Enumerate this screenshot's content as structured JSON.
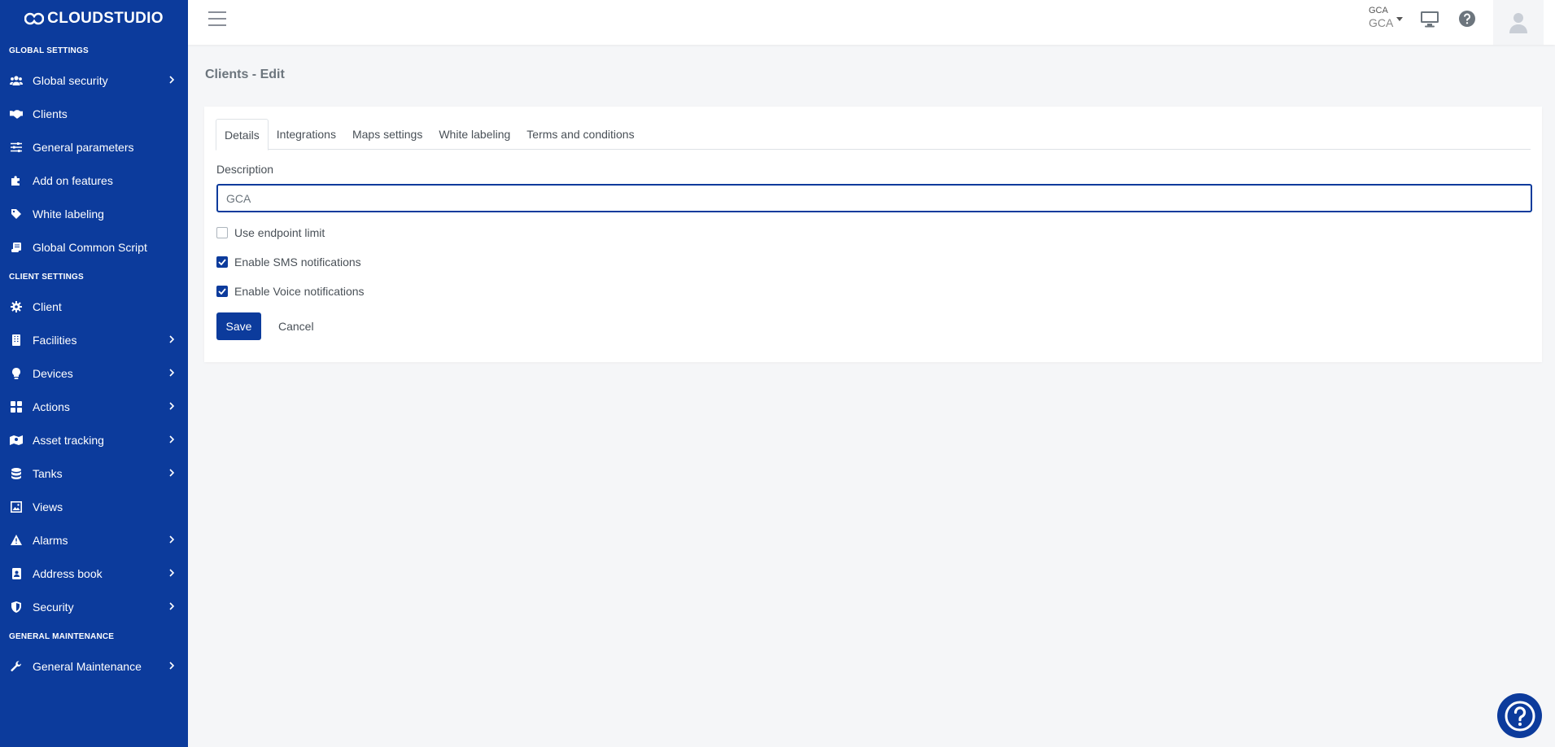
{
  "brand": {
    "name": "CLOUDSTUDIO"
  },
  "sidebar": {
    "sections": [
      {
        "title": "GLOBAL SETTINGS"
      },
      {
        "title": "CLIENT SETTINGS"
      },
      {
        "title": "GENERAL MAINTENANCE"
      }
    ],
    "items": [
      {
        "label": "Global security",
        "icon": "users-icon"
      },
      {
        "label": "Clients",
        "icon": "handshake-icon"
      },
      {
        "label": "General parameters",
        "icon": "sliders-icon"
      },
      {
        "label": "Add on features",
        "icon": "puzzle-icon"
      },
      {
        "label": "White labeling",
        "icon": "tag-icon"
      },
      {
        "label": "Global Common Script",
        "icon": "scroll-icon"
      },
      {
        "label": "Client",
        "icon": "gear-icon"
      },
      {
        "label": "Facilities",
        "icon": "building-icon"
      },
      {
        "label": "Devices",
        "icon": "lightbulb-icon"
      },
      {
        "label": "Actions",
        "icon": "grid-icon"
      },
      {
        "label": "Asset tracking",
        "icon": "map-marker-icon"
      },
      {
        "label": "Tanks",
        "icon": "database-icon"
      },
      {
        "label": "Views",
        "icon": "image-icon"
      },
      {
        "label": "Alarms",
        "icon": "warning-icon"
      },
      {
        "label": "Address book",
        "icon": "address-book-icon"
      },
      {
        "label": "Security",
        "icon": "shield-icon"
      },
      {
        "label": "General Maintenance",
        "icon": "wrench-icon"
      }
    ]
  },
  "topbar": {
    "client_label": "GCA",
    "client_value": "GCA"
  },
  "page": {
    "title": "Clients - Edit"
  },
  "tabs": [
    {
      "label": "Details"
    },
    {
      "label": "Integrations"
    },
    {
      "label": "Maps settings"
    },
    {
      "label": "White labeling"
    },
    {
      "label": "Terms and conditions"
    }
  ],
  "form": {
    "description_label": "Description",
    "description_value": "GCA",
    "checks": [
      {
        "label": "Use endpoint limit",
        "checked": false
      },
      {
        "label": "Enable SMS notifications",
        "checked": true
      },
      {
        "label": "Enable Voice notifications",
        "checked": true
      }
    ],
    "save_label": "Save",
    "cancel_label": "Cancel"
  },
  "colors": {
    "primary": "#0c3b9c",
    "background": "#f5f6f8"
  }
}
